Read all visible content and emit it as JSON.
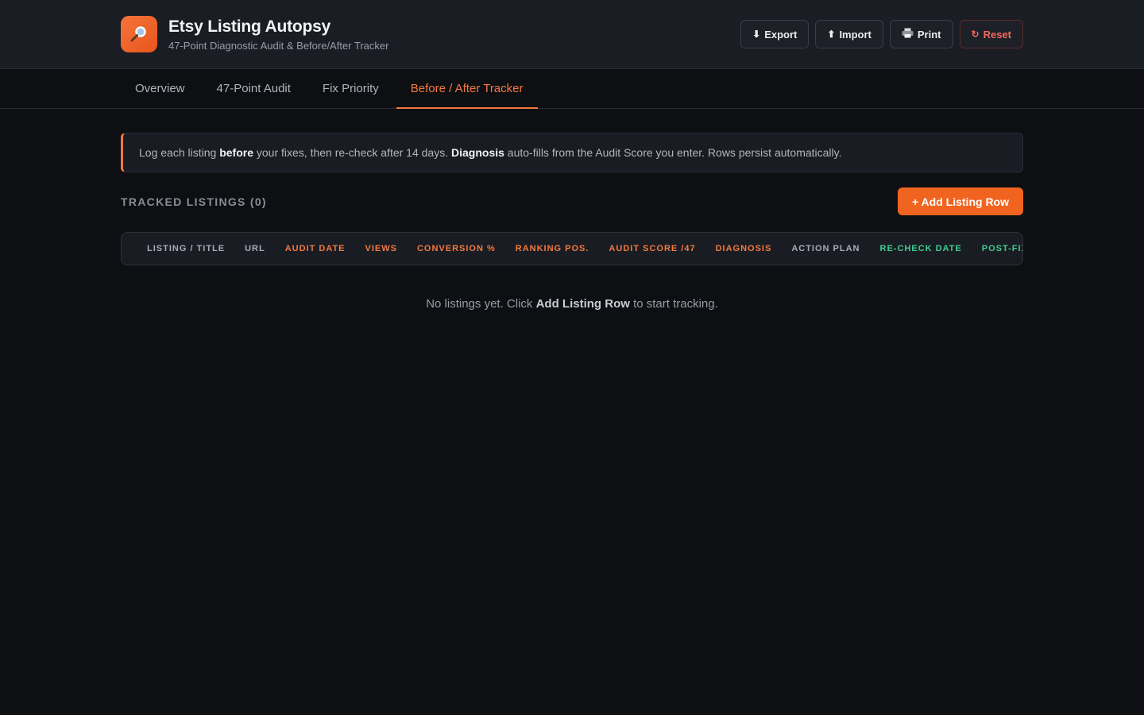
{
  "header": {
    "title": "Etsy Listing Autopsy",
    "subtitle": "47-Point Diagnostic Audit & Before/After Tracker",
    "logo_icon": "magnifier-icon",
    "buttons": {
      "export": "Export",
      "import": "Import",
      "print": "Print",
      "reset": "Reset"
    }
  },
  "tabs": [
    {
      "label": "Overview"
    },
    {
      "label": "47-Point Audit"
    },
    {
      "label": "Fix Priority"
    },
    {
      "label": "Before / After Tracker",
      "active": true
    }
  ],
  "notice": {
    "p1": "Log each listing ",
    "b1": "before",
    "p2": " your fixes, then re-check after 14 days. ",
    "b2": "Diagnosis",
    "p3": " auto-fills from the Audit Score you enter. Rows persist automatically."
  },
  "tracker": {
    "section_title": "TRACKED LISTINGS (0)",
    "add_button": "+ Add Listing Row",
    "columns": [
      {
        "label": "LISTING / TITLE",
        "tone": "grey"
      },
      {
        "label": "URL",
        "tone": "grey"
      },
      {
        "label": "AUDIT DATE",
        "tone": "orange"
      },
      {
        "label": "VIEWS",
        "tone": "orange"
      },
      {
        "label": "CONVERSION %",
        "tone": "orange"
      },
      {
        "label": "RANKING POS.",
        "tone": "orange"
      },
      {
        "label": "AUDIT SCORE /47",
        "tone": "orange"
      },
      {
        "label": "DIAGNOSIS",
        "tone": "orange"
      },
      {
        "label": "ACTION PLAN",
        "tone": "grey"
      },
      {
        "label": "RE-CHECK DATE",
        "tone": "green"
      },
      {
        "label": "POST-FIX VIEWS",
        "tone": "green"
      }
    ],
    "empty": {
      "p1": "No listings yet. Click ",
      "b1": "Add Listing Row",
      "p2": " to start tracking."
    }
  },
  "colors": {
    "accent": "#f27a3f",
    "success": "#3ecf8e",
    "danger": "#f06a5a"
  }
}
